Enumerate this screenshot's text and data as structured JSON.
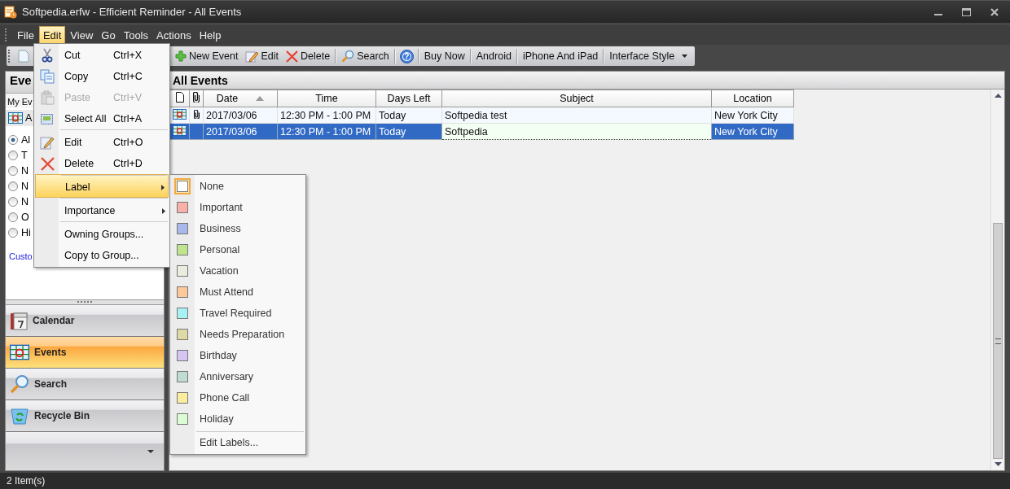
{
  "window": {
    "title": "Softpedia.erfw - Efficient Reminder - All Events"
  },
  "menu_bar": [
    {
      "label": "File",
      "selected": false
    },
    {
      "label": "Edit",
      "selected": true
    },
    {
      "label": "View",
      "selected": false
    },
    {
      "label": "Go",
      "selected": false
    },
    {
      "label": "Tools",
      "selected": false
    },
    {
      "label": "Actions",
      "selected": false
    },
    {
      "label": "Help",
      "selected": false
    }
  ],
  "toolbar": [
    {
      "kind": "icon-text",
      "label": "New Event"
    },
    {
      "kind": "icon-text",
      "label": "Edit"
    },
    {
      "kind": "icon-text",
      "label": "Delete"
    },
    {
      "kind": "icon-text",
      "label": "Search"
    },
    {
      "kind": "icon",
      "label": "?"
    },
    {
      "kind": "text",
      "label": "Buy Now"
    },
    {
      "kind": "text",
      "label": "Android"
    },
    {
      "kind": "text",
      "label": "iPhone And iPad"
    },
    {
      "kind": "dropdown",
      "label": "Interface Style"
    }
  ],
  "left_panel": {
    "header": "Eve",
    "filter_label": "My Ev",
    "view_label": "A",
    "radios": [
      {
        "label": "Al",
        "selected": true
      },
      {
        "label": "T",
        "selected": false
      },
      {
        "label": "N",
        "selected": false
      },
      {
        "label": "N",
        "selected": false
      },
      {
        "label": "N",
        "selected": false
      },
      {
        "label": "O",
        "selected": false
      },
      {
        "label": "Hi",
        "selected": false
      }
    ],
    "link": "Custo",
    "nav": [
      {
        "label": "Calendar",
        "selected": false
      },
      {
        "label": "Events",
        "selected": true
      },
      {
        "label": "Search",
        "selected": false
      },
      {
        "label": "Recycle Bin",
        "selected": false
      }
    ]
  },
  "events": {
    "title": "All Events",
    "columns": [
      {
        "label": "Date",
        "sorted": true
      },
      {
        "label": "Time",
        "sorted": false
      },
      {
        "label": "Days Left",
        "sorted": false
      },
      {
        "label": "Subject",
        "sorted": false
      },
      {
        "label": "Location",
        "sorted": false
      }
    ],
    "rows": [
      {
        "attachment": true,
        "date": "2017/03/06",
        "time": "12:30 PM - 1:00 PM",
        "days_left": "Today",
        "subject": "Softpedia test",
        "location": "New York City",
        "selected": false
      },
      {
        "attachment": false,
        "date": "2017/03/06",
        "time": "12:30 PM - 1:00 PM",
        "days_left": "Today",
        "subject": "Softpedia",
        "location": "New York City",
        "selected": true
      }
    ]
  },
  "edit_menu": [
    {
      "label": "Cut",
      "shortcut": "Ctrl+X",
      "disabled": false,
      "separator_before": false,
      "submenu": false,
      "selected": false
    },
    {
      "label": "Copy",
      "shortcut": "Ctrl+C",
      "disabled": false,
      "separator_before": false,
      "submenu": false,
      "selected": false
    },
    {
      "label": "Paste",
      "shortcut": "Ctrl+V",
      "disabled": true,
      "separator_before": false,
      "submenu": false,
      "selected": false
    },
    {
      "label": "Select All",
      "shortcut": "Ctrl+A",
      "disabled": false,
      "separator_before": false,
      "submenu": false,
      "selected": false
    },
    {
      "label": "Edit",
      "shortcut": "Ctrl+O",
      "disabled": false,
      "separator_before": true,
      "submenu": false,
      "selected": false
    },
    {
      "label": "Delete",
      "shortcut": "Ctrl+D",
      "disabled": false,
      "separator_before": false,
      "submenu": false,
      "selected": false
    },
    {
      "label": "Label",
      "disabled": false,
      "separator_before": true,
      "submenu": true,
      "selected": true
    },
    {
      "label": "Importance",
      "disabled": false,
      "separator_before": true,
      "submenu": true,
      "selected": false
    },
    {
      "label": "Owning Groups...",
      "disabled": false,
      "separator_before": true,
      "submenu": false,
      "selected": false
    },
    {
      "label": "Copy to Group...",
      "disabled": false,
      "separator_before": false,
      "submenu": false,
      "selected": false
    }
  ],
  "label_menu": {
    "items": [
      {
        "label": "None",
        "color": "#ffffff",
        "selected": true
      },
      {
        "label": "Important",
        "color": "#f9b0a8",
        "selected": false
      },
      {
        "label": "Business",
        "color": "#a8b8ea",
        "selected": false
      },
      {
        "label": "Personal",
        "color": "#c0e48e",
        "selected": false
      },
      {
        "label": "Vacation",
        "color": "#ebebdf",
        "selected": false
      },
      {
        "label": "Must Attend",
        "color": "#fbc89a",
        "selected": false
      },
      {
        "label": "Travel Required",
        "color": "#a8f0f4",
        "selected": false
      },
      {
        "label": "Needs Preparation",
        "color": "#dedaa6",
        "selected": false
      },
      {
        "label": "Birthday",
        "color": "#d6c4f2",
        "selected": false
      },
      {
        "label": "Anniversary",
        "color": "#c0dcd2",
        "selected": false
      },
      {
        "label": "Phone Call",
        "color": "#fbeca0",
        "selected": false
      },
      {
        "label": "Holiday",
        "color": "#dcfcd6",
        "selected": false
      }
    ],
    "footer": "Edit Labels..."
  },
  "status_bar": {
    "text": "2 Item(s)"
  }
}
